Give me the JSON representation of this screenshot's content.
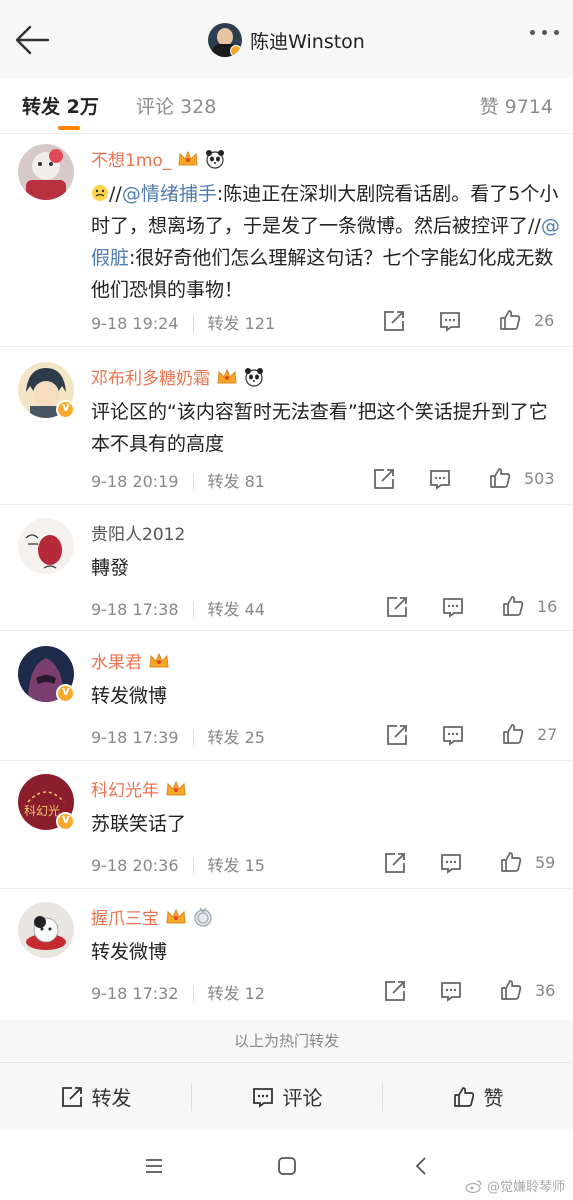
{
  "header": {
    "title": "陈迪Winston"
  },
  "tabs": {
    "forward": "转发 2万",
    "comment": "评论 328",
    "like": "赞 9714"
  },
  "posts": [
    {
      "user": "不想1mo_",
      "content_parts": [
        "//",
        "@情绪捕手",
        ":陈迪正在深圳大剧院看话剧。看了5个小时了，想离场了，于是发了一条微博。然后被控评了//",
        "@假脏",
        ":很好奇他们怎么理解这句话？七个字能幻化成无数他们恐惧的事物！"
      ],
      "time": "9-18 19:24",
      "forward": "转发 121",
      "likes": "26"
    },
    {
      "user": "邓布利多糖奶霜",
      "content": "评论区的“该内容暂时无法查看”把这个笑话提升到了它本不具有的高度",
      "time": "9-18 20:19",
      "forward": "转发 81",
      "likes": "503"
    },
    {
      "user": "贵阳人2012",
      "content": "轉發",
      "time": "9-18 17:38",
      "forward": "转发 44",
      "likes": "16"
    },
    {
      "user": "水果君",
      "content": "转发微博",
      "time": "9-18 17:39",
      "forward": "转发 25",
      "likes": "27"
    },
    {
      "user": "科幻光年",
      "avatar_text": "科幻光",
      "content": "苏联笑话了",
      "time": "9-18 20:36",
      "forward": "转发 15",
      "likes": "59"
    },
    {
      "user": "握爪三宝",
      "content": "转发微博",
      "time": "9-18 17:32",
      "forward": "转发 12",
      "likes": "36"
    }
  ],
  "hot_notice": "以上为热门转发",
  "toolbar": {
    "forward": "转发",
    "comment": "评论",
    "like": "赞"
  },
  "watermark": "@觉嫌聆琴师",
  "colors": {
    "username_vip": "#eb7350",
    "link": "#507daf",
    "accent": "#ff8200",
    "verified": "#f8a92c"
  }
}
